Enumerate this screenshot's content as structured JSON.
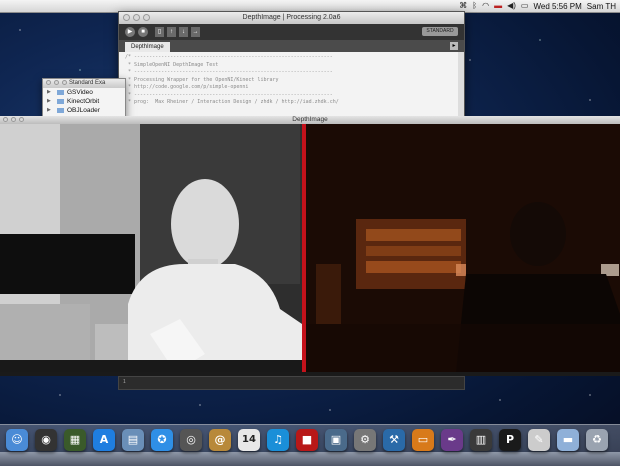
{
  "menubar": {
    "clock": "Wed 5:56 PM",
    "user": "Sam TH",
    "icons": [
      "apple-logo-icon",
      "bluetooth-icon",
      "wifi-icon",
      "flag-icon",
      "volume-icon",
      "battery-icon"
    ]
  },
  "editor": {
    "title": "DepthImage | Processing 2.0a6",
    "mode_button": "STANDARD",
    "tab": "DepthImage",
    "code_lines": [
      "/* ------------------------------------------------------------------",
      " * SimpleOpenNI DepthImage Test",
      " * ------------------------------------------------------------------",
      " * Processing Wrapper for the OpenNI/Kinect library",
      " * http://code.google.com/p/simple-openni",
      " * ------------------------------------------------------------------",
      " * prog:  Max Rheiner / Interaction Design / zhdk / http://iad.zhdk.ch/"
    ]
  },
  "finder": {
    "title": "Standard Exa",
    "items": [
      "GSVideo",
      "KinectOrbit",
      "OBJLoader"
    ]
  },
  "depth_window": {
    "title": "DepthImage"
  },
  "dock": {
    "items": [
      {
        "name": "finder-icon",
        "glyph": "☺",
        "color": "#4a8bd6"
      },
      {
        "name": "dashboard-icon",
        "glyph": "◉",
        "color": "#333"
      },
      {
        "name": "mission-control-icon",
        "glyph": "▦",
        "color": "#3a5a2a"
      },
      {
        "name": "app-store-icon",
        "glyph": "A",
        "color": "#1f7ee0"
      },
      {
        "name": "preview-icon",
        "glyph": "▤",
        "color": "#6a8fb8"
      },
      {
        "name": "safari-icon",
        "glyph": "✪",
        "color": "#2f8fe6"
      },
      {
        "name": "facetime-icon",
        "glyph": "◎",
        "color": "#555"
      },
      {
        "name": "address-book-icon",
        "glyph": "@",
        "color": "#b8893a"
      },
      {
        "name": "calendar-icon",
        "glyph": "14",
        "color": "#e8e8e8"
      },
      {
        "name": "itunes-icon",
        "glyph": "♫",
        "color": "#1a8fd8"
      },
      {
        "name": "photo-booth-icon",
        "glyph": "■",
        "color": "#b81818"
      },
      {
        "name": "iphoto-icon",
        "glyph": "▣",
        "color": "#4a6a8a"
      },
      {
        "name": "system-preferences-icon",
        "glyph": "⚙",
        "color": "#777"
      },
      {
        "name": "xcode-icon",
        "glyph": "⚒",
        "color": "#2a6aa8"
      },
      {
        "name": "keynote-icon",
        "glyph": "▭",
        "color": "#d87a1a"
      },
      {
        "name": "quill-icon",
        "glyph": "✒",
        "color": "#6a3a8a"
      },
      {
        "name": "activity-monitor-icon",
        "glyph": "▥",
        "color": "#3a3a3a"
      },
      {
        "name": "processing-icon",
        "glyph": "P",
        "color": "#1a1a1a"
      },
      {
        "name": "script-editor-icon",
        "glyph": "✎",
        "color": "#ccc"
      },
      {
        "name": "documents-folder-icon",
        "glyph": "▬",
        "color": "#8fb0d8"
      },
      {
        "name": "trash-icon",
        "glyph": "♻",
        "color": "#9aa3b0"
      }
    ],
    "calendar_day": "14"
  }
}
